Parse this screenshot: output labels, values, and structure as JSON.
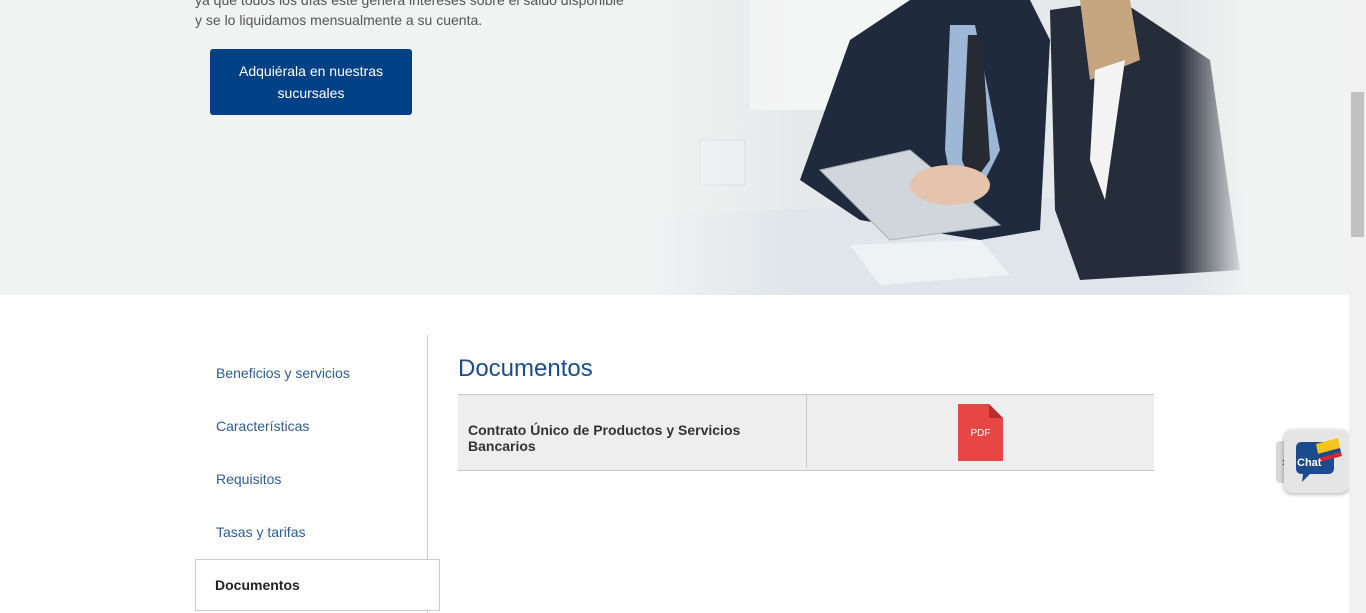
{
  "hero": {
    "line1": "ya que todos los días este genera intereses sobre el saldo disponible",
    "line2": "y se lo liquidamos mensualmente a su cuenta.",
    "cta_label": "Adquiérala en nuestras sucursales"
  },
  "sidebar": {
    "items": [
      {
        "label": "Beneficios y servicios"
      },
      {
        "label": "Características"
      },
      {
        "label": "Requisitos"
      },
      {
        "label": "Tasas y tarifas"
      }
    ],
    "active": {
      "label": "Documentos"
    }
  },
  "documents": {
    "title": "Documentos",
    "rows": [
      {
        "name": "Contrato Único de Productos y Servicios Bancarios",
        "file_type": "PDF"
      }
    ]
  },
  "chat": {
    "label": "Chat",
    "toggle": "›"
  },
  "colors": {
    "brand_blue": "#004085",
    "link_blue": "#2c5d93",
    "pdf_red": "#e84545"
  }
}
